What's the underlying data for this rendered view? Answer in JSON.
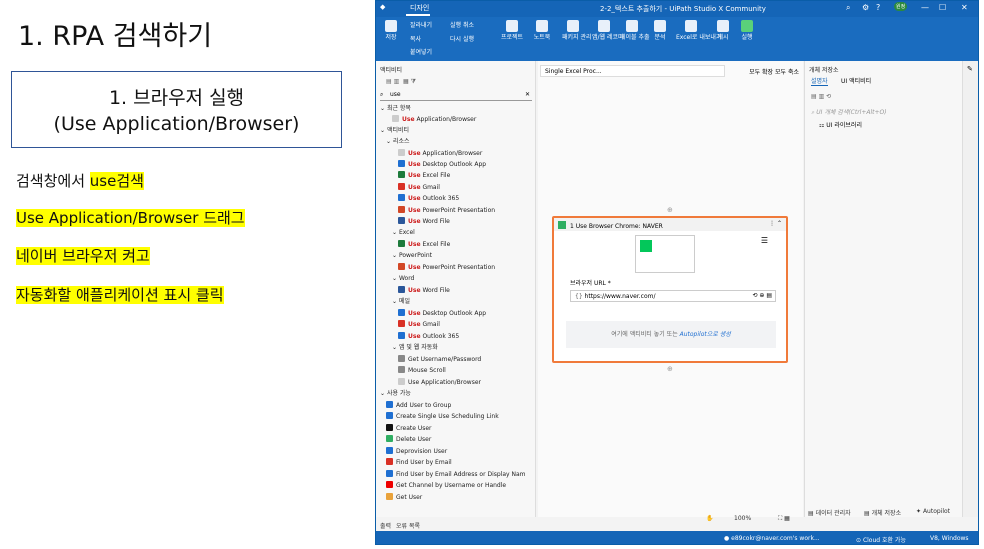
{
  "slide": {
    "title": "1. RPA 검색하기",
    "step_line1": "1. 브라우저 실행",
    "step_line2": "(Use Application/Browser)",
    "notes": [
      {
        "plain": "검색창에서 ",
        "highlight": "use검색"
      },
      {
        "plain": "",
        "highlight": "Use Application/Browser 드래그"
      },
      {
        "plain": "",
        "highlight": "네이버 브라우저 켜고"
      },
      {
        "plain": "",
        "highlight": "자동화할 애플리케이션 표시 클릭"
      }
    ]
  },
  "studio": {
    "tab": "디자인",
    "window_title": "2-2_텍스트 추출하기 - UiPath Studio X Community",
    "user_badge": "원정",
    "ribbon": {
      "save": "저장",
      "cut": "잘라내기",
      "undo": "실행 취소",
      "copy": "복사",
      "redo": "다시 실행",
      "paste": "붙여넣기",
      "project": "프로젝트",
      "notebook": "노트북",
      "package_manager": "패키지 관리",
      "app_recorder": "앱/웹 레코더",
      "table_extract": "테이블 추출",
      "analyze": "분석",
      "excel_export": "Excel로 내보내기",
      "publish": "게시",
      "run": "실행"
    },
    "activities": {
      "header": "액티비티",
      "search_value": "use",
      "recent_group": "최근 항목",
      "recent_item": "Application/Browser",
      "activity_group": "액티비티",
      "resources_group": "리소스",
      "resources": [
        "Application/Browser",
        "Desktop Outlook App",
        "Excel File",
        "Gmail",
        "Outlook 365",
        "PowerPoint Presentation",
        "Word File"
      ],
      "excel_group": "Excel",
      "excel_item": "Excel File",
      "ppt_group": "PowerPoint",
      "ppt_item": "PowerPoint Presentation",
      "word_group": "Word",
      "word_item": "Word File",
      "mail_group": "메일",
      "mail_items": [
        "Desktop Outlook App",
        "Gmail",
        "Outlook 365"
      ],
      "appweb_group": "앱 및 웹 자동화",
      "appweb_items": [
        "Get Username/Password",
        "Mouse Scroll",
        "Use Application/Browser"
      ],
      "available_group": "사용 가능",
      "available_items": [
        "Add User to Group",
        "Create Single Use Scheduling Link",
        "Create User",
        "Delete User",
        "Deprovision User",
        "Find User by Email",
        "Find User by Email Address or Display Nam",
        "Get Channel by Username or Handle",
        "Get User"
      ],
      "use_word": "Use"
    },
    "designer": {
      "tab": "Single Excel Proc...",
      "expand_all": "모두 확장",
      "collapse_all": "모두 축소",
      "card_title": "1  Use Browser Chrome: NAVER",
      "url_label": "브라우저 URL *",
      "url_value": "https://www.naver.com/",
      "drop_text": "여기에 액티비티 놓기 또는 ",
      "autopilot_link": "Autopilot으로 생성",
      "zoom": "100%"
    },
    "objects": {
      "header": "개체 저장소",
      "tab_descriptor": "설명자",
      "tab_ui_activity": "UI 액티비티",
      "search_placeholder": "UI 개체 검색(Ctrl+Alt+O)",
      "library": "UI 라이브러리"
    },
    "bottom": {
      "output": "출력",
      "errors": "오류 목록",
      "data_manager": "데이터 관리자",
      "obj_store": "개체 저장소",
      "autopilot": "Autopilot"
    },
    "status": {
      "account": "e89cokr@naver.com's work...",
      "cloud": "Cloud 호환 가능",
      "platform": "V8, Windows"
    },
    "colors": {
      "accent": "#1565b7",
      "card_border": "#f07a3a",
      "highlight": "#ffff00"
    }
  }
}
